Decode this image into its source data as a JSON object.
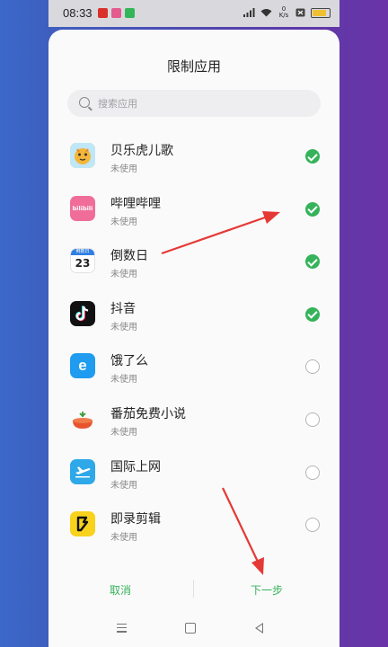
{
  "status": {
    "time": "08:33",
    "net_speed": "0 K/s",
    "battery_level": 0.85,
    "notif_colors": [
      "#d9302b",
      "#e35b8f",
      "#34b55a"
    ]
  },
  "sheet": {
    "title": "限制应用",
    "search_placeholder": "搜索应用"
  },
  "apps": [
    {
      "name": "贝乐虎儿歌",
      "status": "未使用",
      "checked": true,
      "icon_color": "#f4c43a"
    },
    {
      "name": "哔哩哔哩",
      "status": "未使用",
      "checked": true,
      "icon_color": "#f06d9a",
      "icon_text": "bilibili"
    },
    {
      "name": "倒数日",
      "status": "未使用",
      "checked": true,
      "icon_color": "#ffffff",
      "icon_text": "23",
      "icon_header": "倒数日"
    },
    {
      "name": "抖音",
      "status": "未使用",
      "checked": true,
      "icon_color": "#111111"
    },
    {
      "name": "饿了么",
      "status": "未使用",
      "checked": false,
      "icon_color": "#1f9cf0",
      "icon_text": "e"
    },
    {
      "name": "番茄免费小说",
      "status": "未使用",
      "checked": false,
      "icon_color": "#e8532e"
    },
    {
      "name": "国际上网",
      "status": "未使用",
      "checked": false,
      "icon_color": "#2ea8e8"
    },
    {
      "name": "即录剪辑",
      "status": "未使用",
      "checked": false,
      "icon_color": "#f8d21c"
    }
  ],
  "buttons": {
    "cancel": "取消",
    "next": "下一步"
  },
  "colors": {
    "accent": "#36b35a",
    "annotation_arrow": "#e53935"
  }
}
